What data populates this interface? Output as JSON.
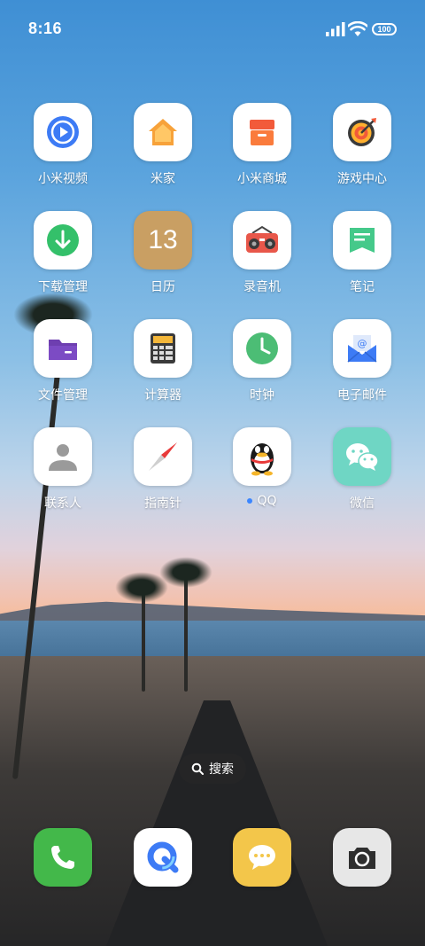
{
  "status": {
    "time": "8:16",
    "battery": "100"
  },
  "apps": [
    {
      "label": "小米视频",
      "icon": "video-play-icon"
    },
    {
      "label": "米家",
      "icon": "home-icon"
    },
    {
      "label": "小米商城",
      "icon": "store-box-icon"
    },
    {
      "label": "游戏中心",
      "icon": "target-icon"
    },
    {
      "label": "下载管理",
      "icon": "download-icon"
    },
    {
      "label": "日历",
      "icon": "calendar-icon",
      "badge": "13"
    },
    {
      "label": "录音机",
      "icon": "radio-recorder-icon"
    },
    {
      "label": "笔记",
      "icon": "notes-icon"
    },
    {
      "label": "文件管理",
      "icon": "folder-icon"
    },
    {
      "label": "计算器",
      "icon": "calculator-icon"
    },
    {
      "label": "时钟",
      "icon": "clock-icon"
    },
    {
      "label": "电子邮件",
      "icon": "mail-icon"
    },
    {
      "label": "联系人",
      "icon": "contact-icon"
    },
    {
      "label": "指南针",
      "icon": "compass-icon"
    },
    {
      "label": "QQ",
      "icon": "qq-penguin-icon",
      "dot": true
    },
    {
      "label": "微信",
      "icon": "wechat-icon"
    }
  ],
  "search": {
    "label": "搜索"
  },
  "dock": [
    {
      "name": "phone",
      "icon": "phone-icon"
    },
    {
      "name": "browser",
      "icon": "browser-icon"
    },
    {
      "name": "messages",
      "icon": "message-icon"
    },
    {
      "name": "camera",
      "icon": "camera-icon"
    }
  ]
}
